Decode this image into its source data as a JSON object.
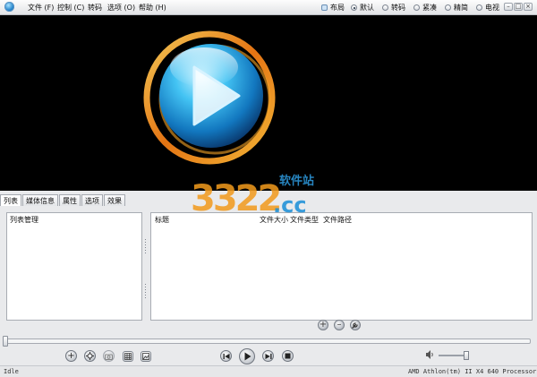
{
  "menu": {
    "items": [
      "文件 (F)",
      "控制 (C)",
      "转码",
      "选项 (O)",
      "帮助 (H)"
    ]
  },
  "layout_bar": {
    "label": "布局",
    "options": [
      {
        "label": "默认",
        "selected": true
      },
      {
        "label": "转码",
        "selected": false
      },
      {
        "label": "紧凑",
        "selected": false
      },
      {
        "label": "精简",
        "selected": false
      },
      {
        "label": "电视",
        "selected": false
      }
    ]
  },
  "window_buttons": {
    "minimize": "–",
    "maximize": "□",
    "close": "×"
  },
  "tabs": [
    {
      "label": "列表",
      "active": true
    },
    {
      "label": "媒体信息",
      "active": false
    },
    {
      "label": "属性",
      "active": false
    },
    {
      "label": "选项",
      "active": false
    },
    {
      "label": "效果",
      "active": false
    }
  ],
  "left_panel": {
    "header": "列表管理"
  },
  "right_panel": {
    "columns": [
      "标题",
      "文件大小",
      "文件类型",
      "文件路径"
    ]
  },
  "playlist_buttons": {
    "add": "+",
    "remove": "–",
    "tools": "wrench-icon"
  },
  "controls": {
    "left_icons": [
      "add-circle-icon",
      "settings-circle-icon",
      "camera-icon",
      "grid-icon",
      "gallery-icon"
    ],
    "playback": [
      "previous-icon",
      "play-icon",
      "next-icon",
      "stop-icon"
    ],
    "volume_level": 0.85
  },
  "seek": {
    "position": 0.0
  },
  "status": {
    "left": "Idle",
    "right": "AMD Athlon(tm) II X4 640 Processor"
  },
  "watermark": {
    "number": "3322",
    "domain": ".cc",
    "site": "软件站"
  },
  "colors": {
    "play_ring_outer": "#f29a1d",
    "play_ball": "#2aa6e6",
    "watermark_blue": "#1a8fd8"
  }
}
